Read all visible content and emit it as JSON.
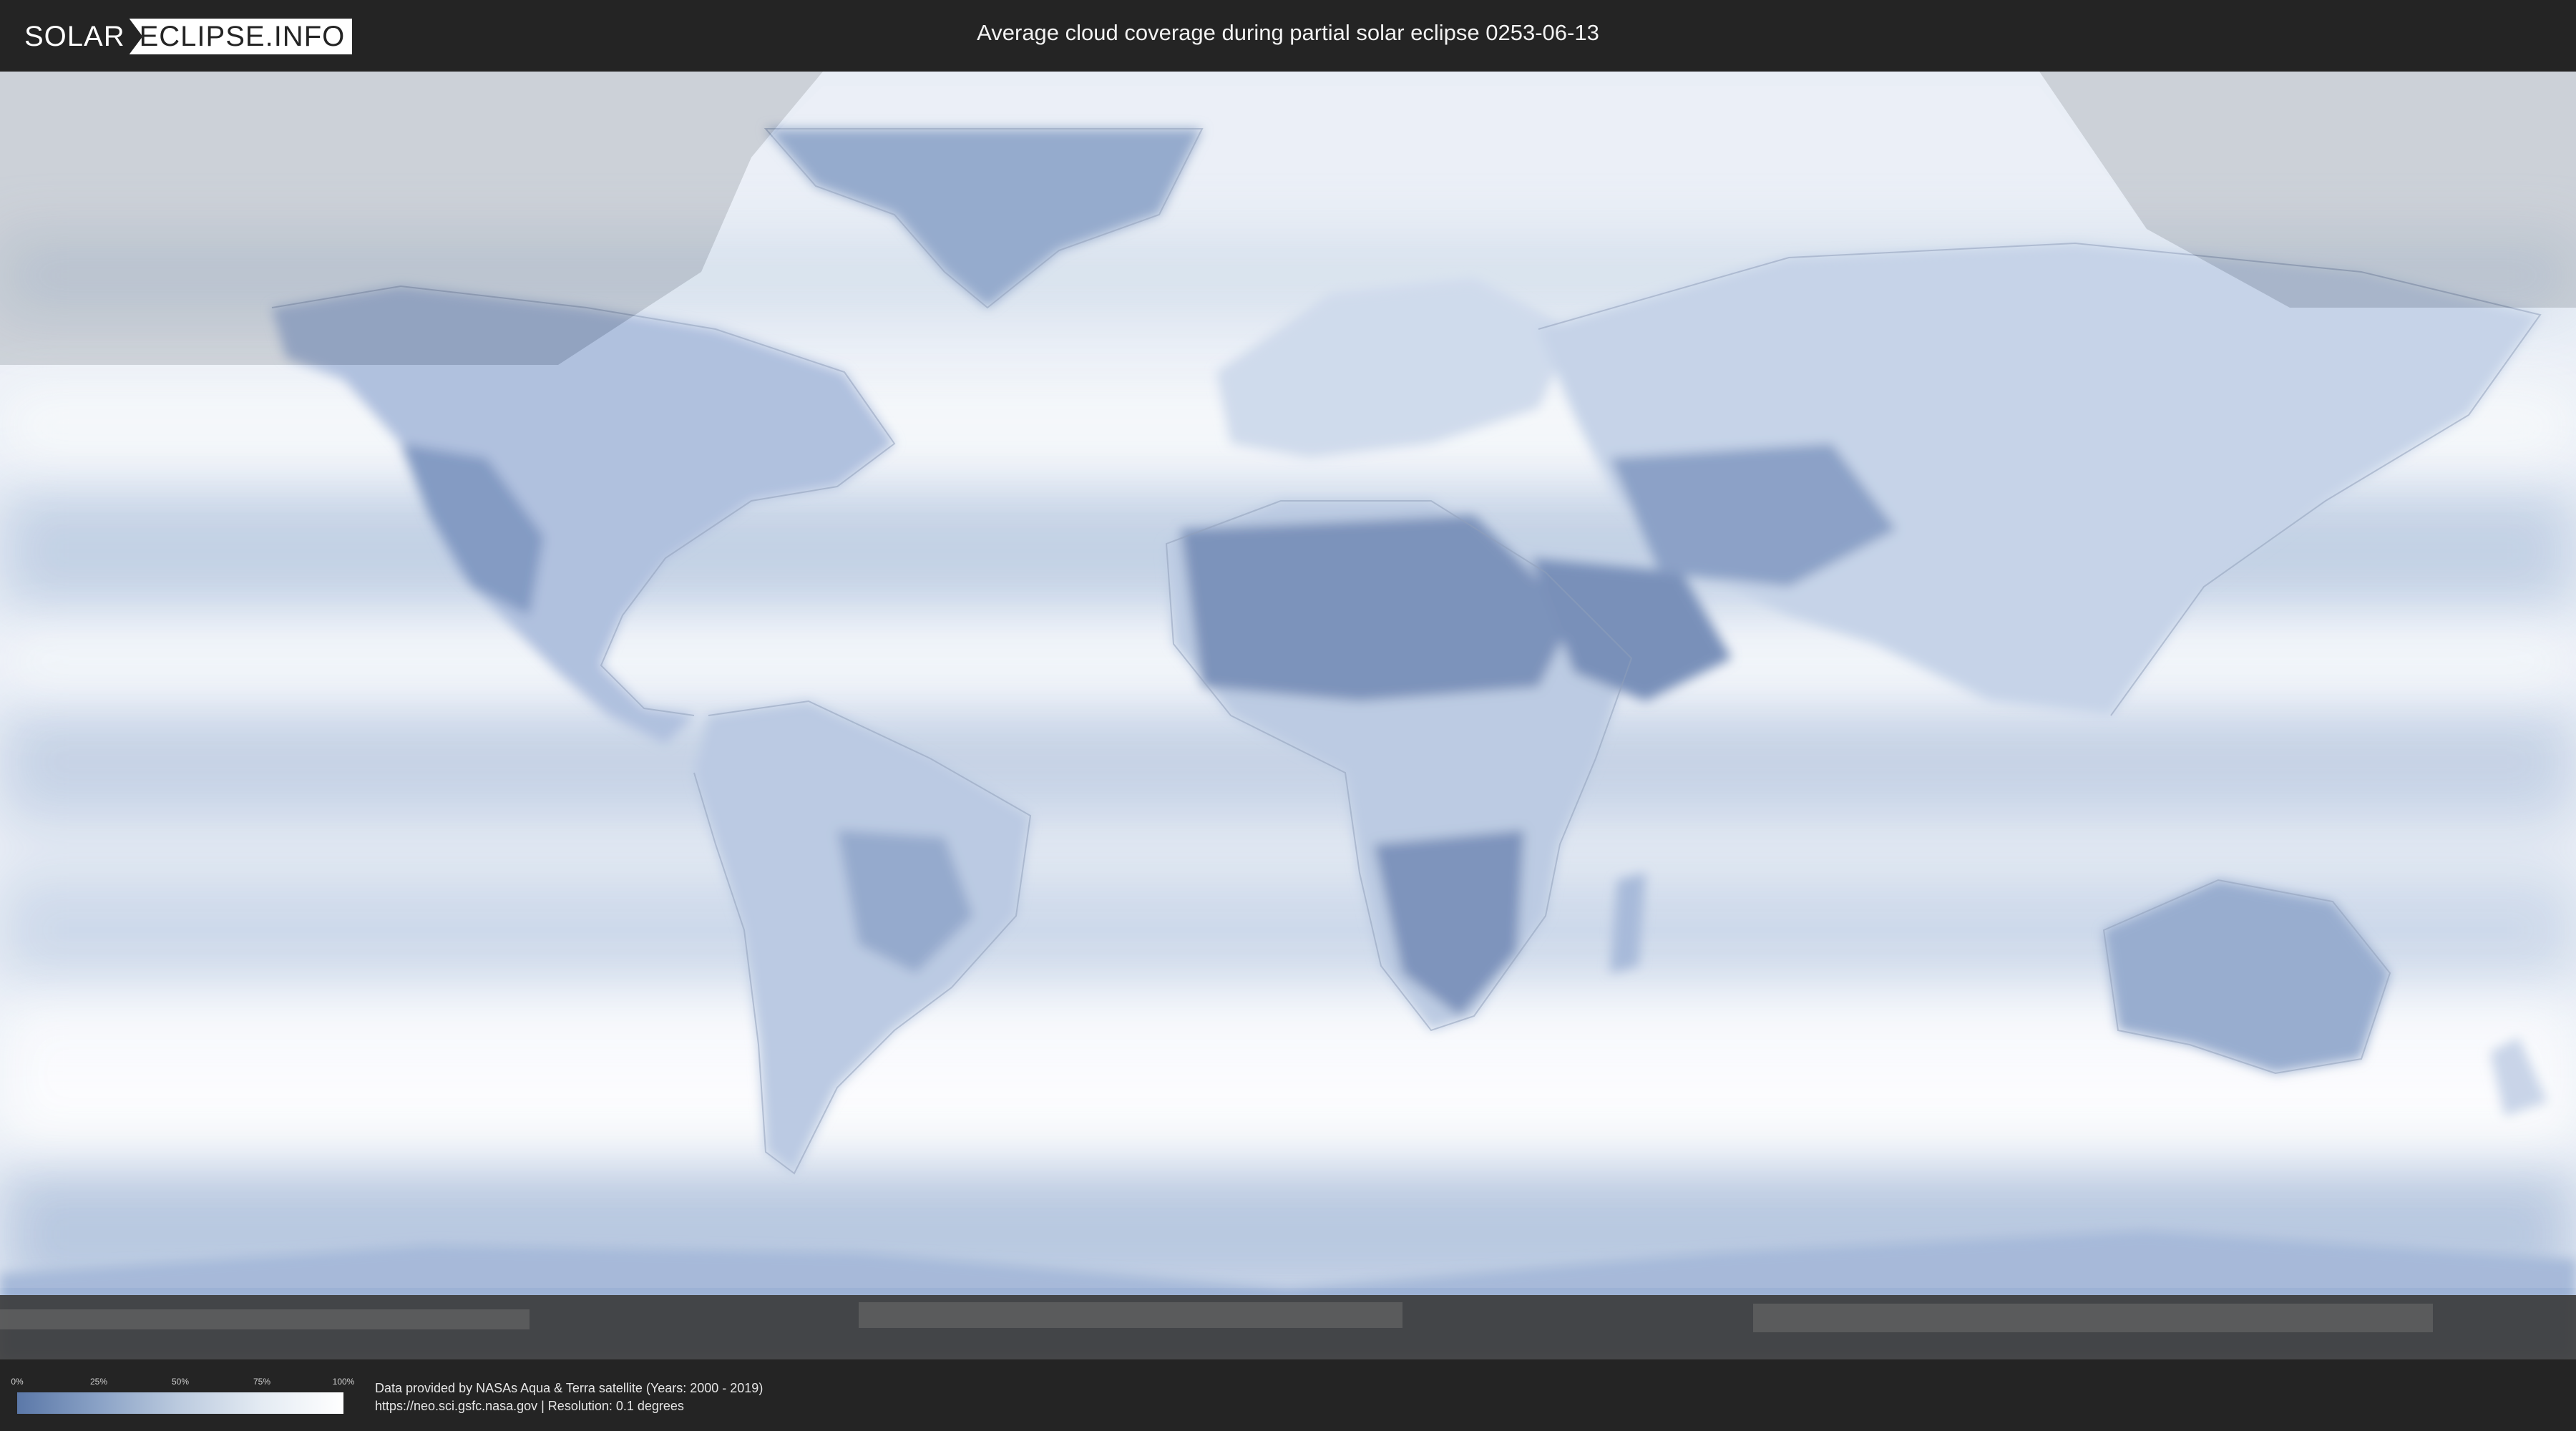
{
  "header": {
    "logo_part1": "SOLAR",
    "logo_part2": "ECLIPSE.INFO",
    "title": "Average cloud coverage during partial solar eclipse 0253-06-13"
  },
  "legend": {
    "ticks": [
      "0%",
      "25%",
      "50%",
      "75%",
      "100%"
    ],
    "gradient_colors": [
      "#5b78a8",
      "#8aa2c6",
      "#bccbdf",
      "#e4ebf3",
      "#ffffff"
    ]
  },
  "footer": {
    "source_line": "Data provided by NASAs Aqua & Terra satellite (Years: 2000 - 2019)",
    "url_line": "https://neo.sci.gsfc.nasa.gov | Resolution: 0.1 degrees"
  },
  "map": {
    "type": "world cloud coverage map",
    "colors": {
      "clear_land": "#6f88b4",
      "cloudy": "#f4f7fb",
      "ocean_mid": "#c9d6e8",
      "shadow_overlay": "#000000",
      "bottom_band": "#3c3c3c"
    }
  }
}
